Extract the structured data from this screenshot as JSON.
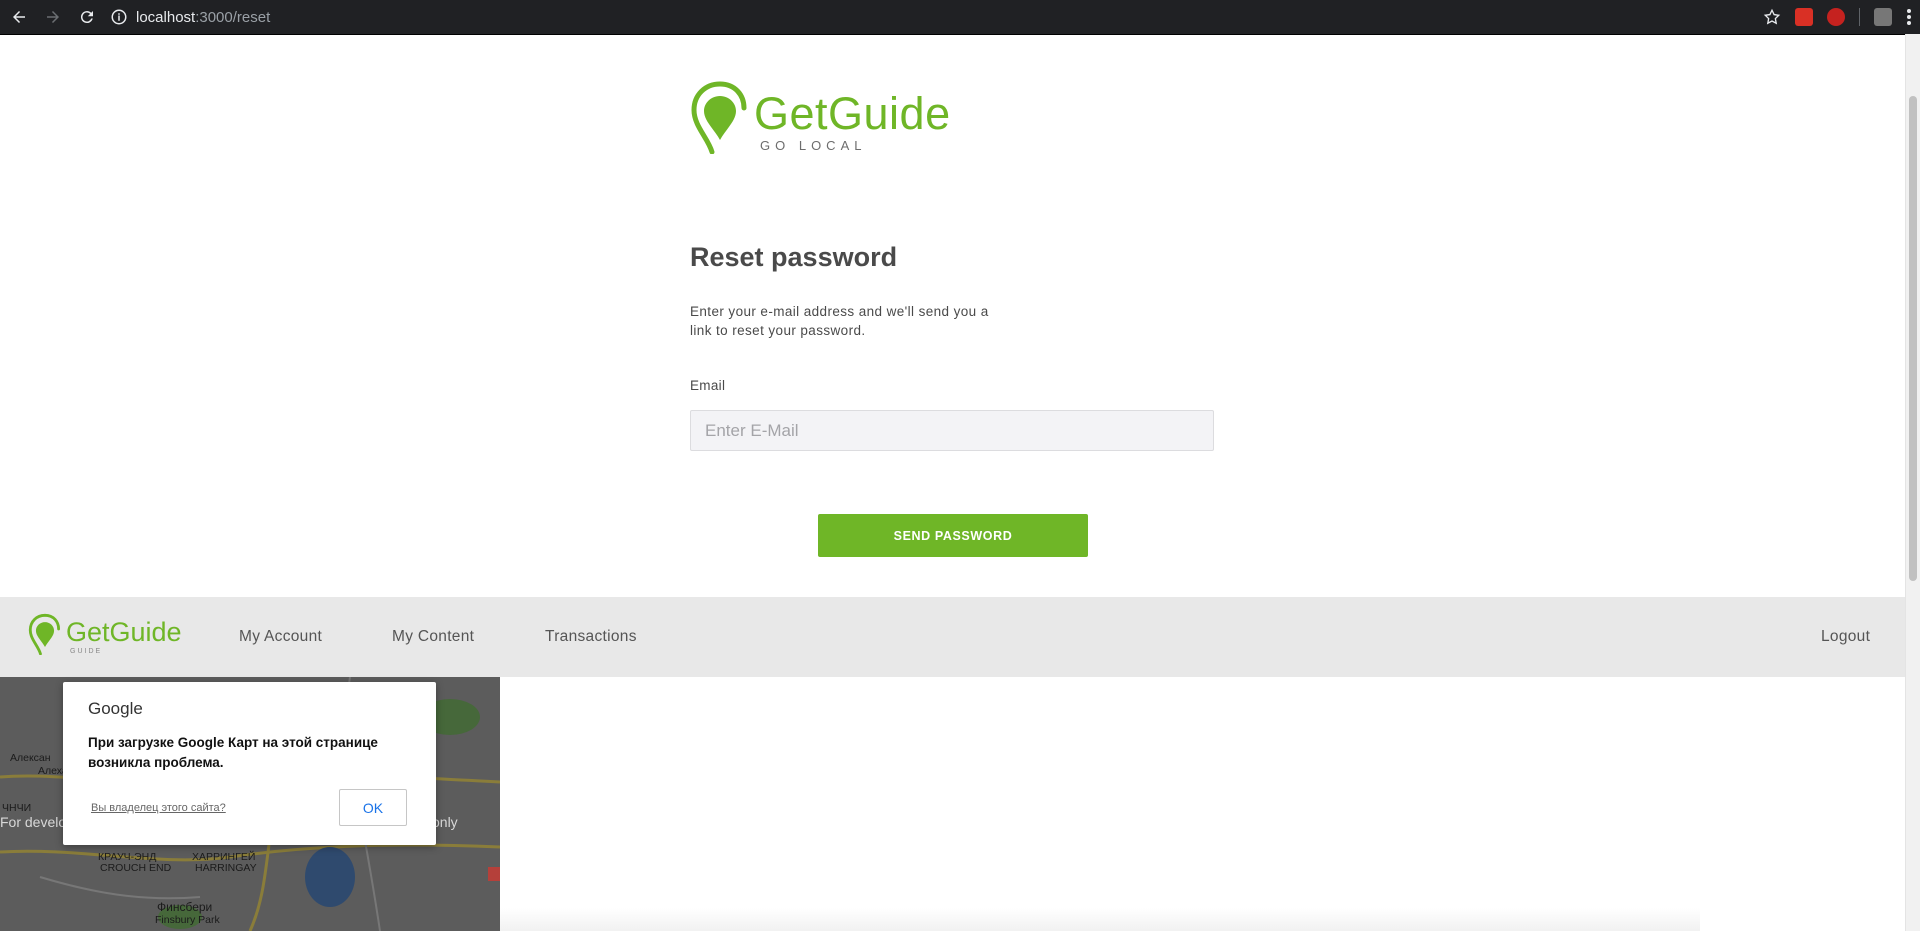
{
  "browser": {
    "url_host": "localhost",
    "url_rest": ":3000/reset"
  },
  "logo": {
    "brand": "GetGuide",
    "tagline": "GO LOCAL"
  },
  "form": {
    "title": "Reset password",
    "description": "Enter your e-mail address and we'll send you a link to reset your password.",
    "email_label": "Email",
    "email_placeholder": "Enter E-Mail",
    "email_value": "",
    "submit_label": "SEND PASSWORD"
  },
  "footer": {
    "brand": "GetGuide",
    "tagline": "GUIDE",
    "links": [
      "My Account",
      "My Content",
      "Transactions"
    ],
    "logout": "Logout"
  },
  "map": {
    "notice_left": "For develo",
    "notice_right": "only",
    "places": [
      "Алексан",
      "Алеха",
      "ЧНЧИ",
      "КРАУЧ-ЭНД",
      "CROUCH END",
      "ХАРРИНГЕЙ",
      "HARRINGAY",
      "Финсбери",
      "Finsbury Park"
    ]
  },
  "map_dialog": {
    "provider": "Google",
    "message": "При загрузке Google Карт на этой странице возникла проблема.",
    "owner_link": "Вы владелец этого сайта?",
    "ok_label": "OK"
  },
  "colors": {
    "brand_green": "#6fb627",
    "chrome_bg": "#202124",
    "footer_bg": "#e8e8e8"
  }
}
